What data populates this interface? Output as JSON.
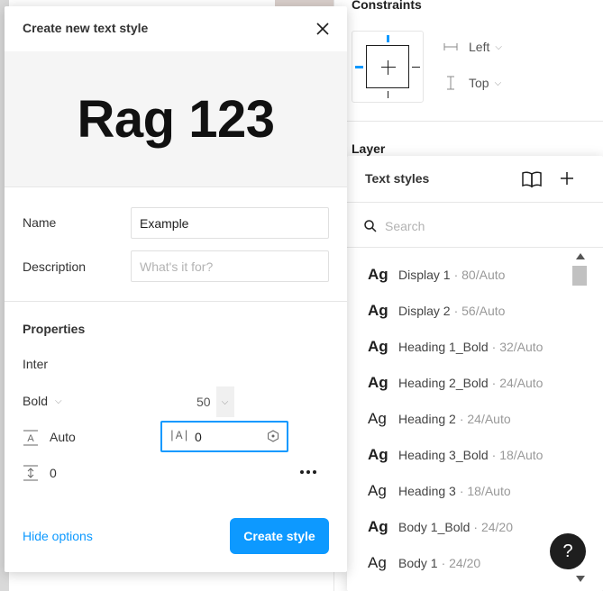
{
  "inspector": {
    "constraints_heading": "Constraints",
    "horizontal_constraint": "Left",
    "vertical_constraint": "Top",
    "layer_heading": "Layer"
  },
  "text_styles_panel": {
    "title": "Text styles",
    "search_placeholder": "Search",
    "items": [
      {
        "sample": "Ag",
        "name": "Display 1",
        "meta": "· 80/Auto",
        "bold": true
      },
      {
        "sample": "Ag",
        "name": "Display 2",
        "meta": "· 56/Auto",
        "bold": true
      },
      {
        "sample": "Ag",
        "name": "Heading 1_Bold",
        "meta": "· 32/Auto",
        "bold": true
      },
      {
        "sample": "Ag",
        "name": "Heading 2_Bold",
        "meta": "· 24/Auto",
        "bold": true
      },
      {
        "sample": "Ag",
        "name": "Heading 2",
        "meta": "· 24/Auto",
        "bold": false
      },
      {
        "sample": "Ag",
        "name": "Heading 3_Bold",
        "meta": "· 18/Auto",
        "bold": true
      },
      {
        "sample": "Ag",
        "name": "Heading 3",
        "meta": "· 18/Auto",
        "bold": false
      },
      {
        "sample": "Ag",
        "name": "Body 1_Bold",
        "meta": "· 24/20",
        "bold": true
      },
      {
        "sample": "Ag",
        "name": "Body 1",
        "meta": "· 24/20",
        "bold": false
      }
    ],
    "help_label": "?"
  },
  "modal": {
    "title": "Create new text style",
    "preview_text": "Rag 123",
    "name_label": "Name",
    "name_value": "Example",
    "description_label": "Description",
    "description_placeholder": "What's it for?",
    "properties_heading": "Properties",
    "font_family": "Inter",
    "font_weight": "Bold",
    "font_size": "50",
    "line_height": "Auto",
    "letter_spacing_icon": "|A|",
    "letter_spacing": "0",
    "paragraph_spacing": "0",
    "hide_options_label": "Hide options",
    "create_button_label": "Create style"
  },
  "colors": {
    "accent": "#0d99ff",
    "text": "#1e1e1e",
    "muted": "#999999"
  }
}
